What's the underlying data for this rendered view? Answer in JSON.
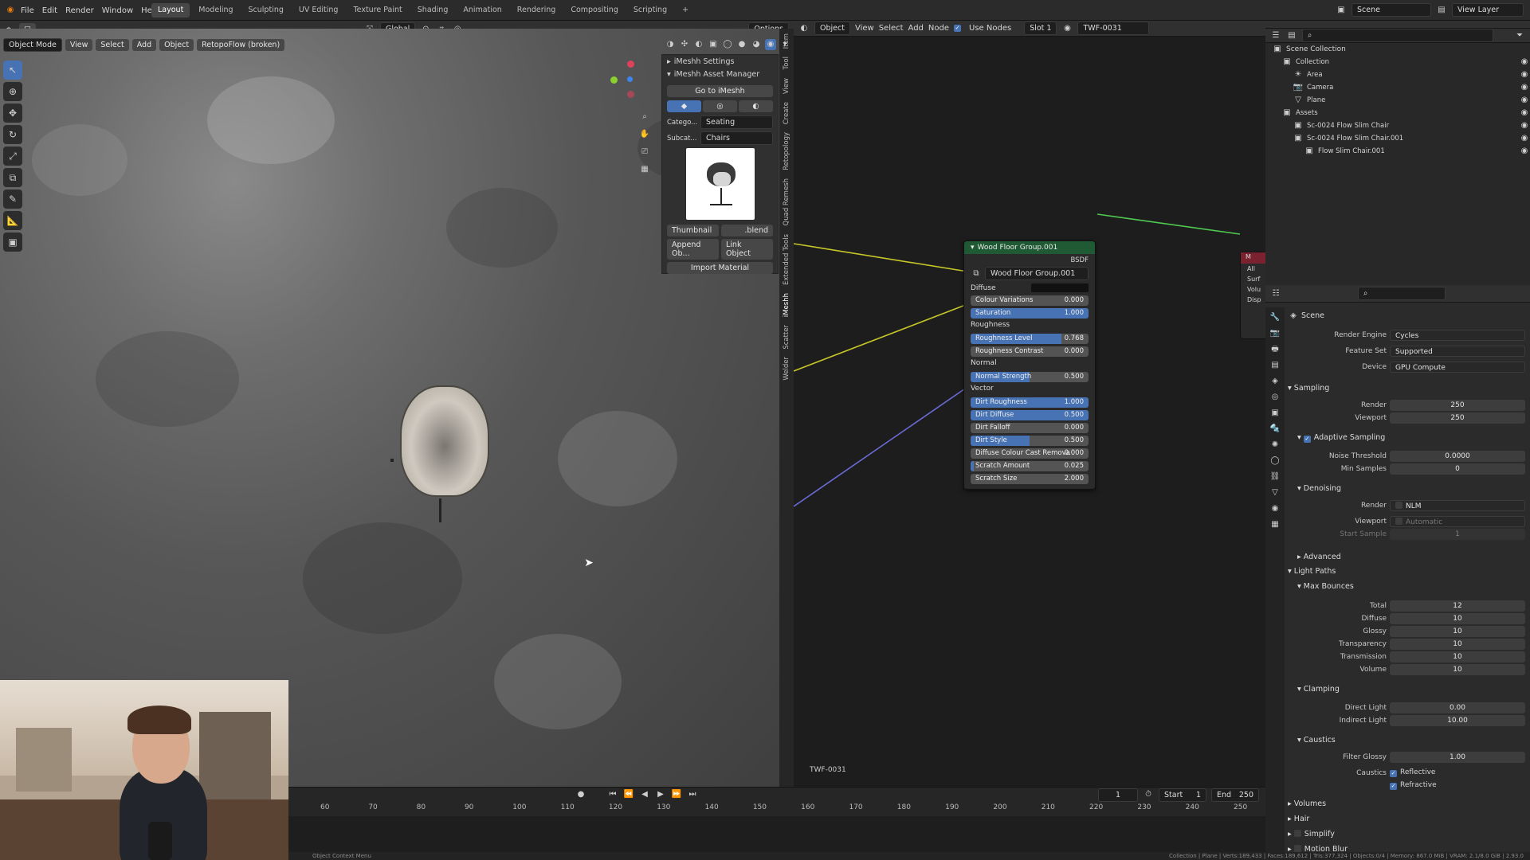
{
  "app": {
    "menus": [
      "File",
      "Edit",
      "Render",
      "Window",
      "Help"
    ],
    "workspaces": [
      "Layout",
      "Modeling",
      "Sculpting",
      "UV Editing",
      "Texture Paint",
      "Shading",
      "Animation",
      "Rendering",
      "Compositing",
      "Scripting"
    ],
    "active_workspace": "Layout",
    "scene_label": "Scene",
    "view_layer_label": "View Layer"
  },
  "viewport": {
    "mode": "Object Mode",
    "menus": [
      "View",
      "Select",
      "Add",
      "Object"
    ],
    "retopo_addon": "RetopoFlow (broken)",
    "transform_orientation": "Global",
    "options_label": "Options"
  },
  "imeshh": {
    "settings_label": "iMeshh Settings",
    "asset_manager_label": "iMeshh Asset Manager",
    "goto_label": "Go to iMeshh",
    "category_label": "Catego...",
    "category_value": "Seating",
    "subcategory_label": "Subcat...",
    "subcategory_value": "Chairs",
    "thumbnail_label": "Thumbnail",
    "blend_label": ".blend",
    "append_label": "Append Ob...",
    "link_label": "Link Object",
    "import_material_label": "Import Material"
  },
  "n_tabs": [
    "Item",
    "Tool",
    "View",
    "Create",
    "Retopology",
    "Quad Remesh",
    "Extended Tools",
    "iMeshh",
    "Scatter",
    "Welder"
  ],
  "node_editor": {
    "object_label": "Object",
    "menus": [
      "View",
      "Select",
      "Add",
      "Node"
    ],
    "use_nodes_label": "Use Nodes",
    "slot_label": "Slot 1",
    "material_name": "TWF-0031",
    "footer_material": "TWF-0031",
    "node": {
      "title": "Wood Floor Group.001",
      "output_label": "BSDF",
      "group_name": "Wood Floor Group.001",
      "diffuse_label": "Diffuse",
      "roughness_label": "Roughness",
      "normal_label": "Normal",
      "vector_label": "Vector",
      "fields": [
        {
          "label": "Colour Variations",
          "value": "0.000",
          "fill": 0
        },
        {
          "label": "Saturation",
          "value": "1.000",
          "fill": 1
        },
        {
          "label": "Roughness Level",
          "value": "0.768",
          "fill": 0.768
        },
        {
          "label": "Roughness Contrast",
          "value": "0.000",
          "fill": 0
        },
        {
          "label": "Normal Strength",
          "value": "0.500",
          "fill": 0.5
        },
        {
          "label": "Dirt Roughness",
          "value": "1.000",
          "fill": 1
        },
        {
          "label": "Dirt Diffuse",
          "value": "0.500",
          "fill": 1
        },
        {
          "label": "Dirt Falloff",
          "value": "0.000",
          "fill": 0
        },
        {
          "label": "Dirt Style",
          "value": "0.500",
          "fill": 0.5
        },
        {
          "label": "Diffuse Colour Cast Remova",
          "value": "0.000",
          "fill": 0
        },
        {
          "label": "Scratch Amount",
          "value": "0.025",
          "fill": 0.025
        },
        {
          "label": "Scratch Size",
          "value": "2.000",
          "fill": 0
        }
      ]
    },
    "output_node": {
      "title": "M",
      "sockets": [
        "All",
        "Surf",
        "Volu",
        "Disp"
      ]
    }
  },
  "outliner": {
    "root": "Scene Collection",
    "items": [
      {
        "name": "Collection",
        "level": 0
      },
      {
        "name": "Area",
        "level": 1
      },
      {
        "name": "Camera",
        "level": 1
      },
      {
        "name": "Plane",
        "level": 1
      },
      {
        "name": "Assets",
        "level": 0
      },
      {
        "name": "Sc-0024 Flow Slim Chair",
        "level": 1
      },
      {
        "name": "Sc-0024 Flow Slim Chair.001",
        "level": 1
      },
      {
        "name": "Flow Slim Chair.001",
        "level": 2
      }
    ]
  },
  "properties": {
    "context": "Scene",
    "render_engine_label": "Render Engine",
    "render_engine": "Cycles",
    "feature_set_label": "Feature Set",
    "feature_set": "Supported",
    "device_label": "Device",
    "device": "GPU Compute",
    "sampling_label": "Sampling",
    "render_label": "Render",
    "render_samples": "250",
    "viewport_label": "Viewport",
    "viewport_samples": "250",
    "adaptive_label": "Adaptive Sampling",
    "noise_threshold_label": "Noise Threshold",
    "noise_threshold": "0.0000",
    "min_samples_label": "Min Samples",
    "min_samples": "0",
    "denoising_label": "Denoising",
    "denoise_render": "NLM",
    "denoise_viewport": "Automatic",
    "start_sample_label": "Start Sample",
    "start_sample": "1",
    "advanced_label": "Advanced",
    "light_paths_label": "Light Paths",
    "max_bounces_label": "Max Bounces",
    "bounces": [
      {
        "label": "Total",
        "value": "12"
      },
      {
        "label": "Diffuse",
        "value": "10"
      },
      {
        "label": "Glossy",
        "value": "10"
      },
      {
        "label": "Transparency",
        "value": "10"
      },
      {
        "label": "Transmission",
        "value": "10"
      },
      {
        "label": "Volume",
        "value": "10"
      }
    ],
    "clamping_label": "Clamping",
    "direct_light_label": "Direct Light",
    "direct_light": "0.00",
    "indirect_light_label": "Indirect Light",
    "indirect_light": "10.00",
    "caustics_label": "Caustics",
    "filter_glossy_label": "Filter Glossy",
    "filter_glossy": "1.00",
    "caustics_row_label": "Caustics",
    "reflective_label": "Reflective",
    "refractive_label": "Refractive",
    "more_sections": [
      "Volumes",
      "Hair",
      "Simplify",
      "Motion Blur"
    ]
  },
  "timeline": {
    "frame_current": "1",
    "start_label": "Start",
    "start": "1",
    "end_label": "End",
    "end": "250",
    "ticks": [
      "60",
      "70",
      "80",
      "90",
      "100",
      "110",
      "120",
      "130",
      "140",
      "150",
      "160",
      "170",
      "180",
      "190",
      "200",
      "210",
      "220",
      "230",
      "240",
      "250"
    ]
  },
  "status": {
    "left": "Object Context Menu",
    "right": "Collection | Plane | Verts:189,433 | Faces:189,612 | Tris:377,324 | Objects:0/4 | Memory: 867.0 MiB | VRAM: 2.1/8.0 GiB | 2.93.0"
  }
}
